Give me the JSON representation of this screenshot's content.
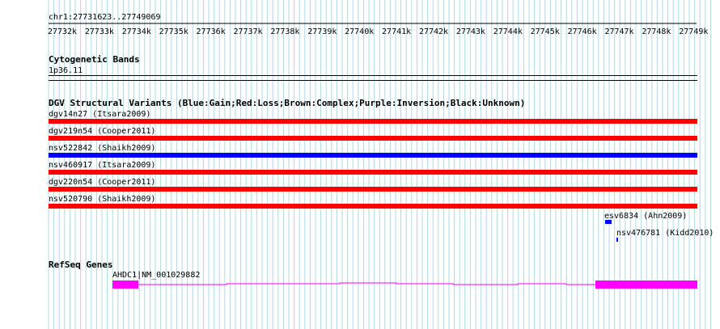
{
  "ruler": {
    "position": "chr1:27731623..27749069",
    "ticks": [
      "27732k",
      "27733k",
      "27734k",
      "27735k",
      "27736k",
      "27737k",
      "27738k",
      "27739k",
      "27740k",
      "27741k",
      "27742k",
      "27743k",
      "27744k",
      "27745k",
      "27746k",
      "27747k",
      "27748k",
      "27749k"
    ]
  },
  "cytoband": {
    "title": "Cytogenetic Bands",
    "band": "1p36.11"
  },
  "dgv": {
    "title": "DGV Structural Variants (Blue:Gain;Red:Loss;Brown:Complex;Purple:Inversion;Black:Unknown)",
    "variants": [
      {
        "label": "dgv14n27 (Itsara2009)",
        "color": "#ff0000"
      },
      {
        "label": "dgv219n54 (Cooper2011)",
        "color": "#ff0000"
      },
      {
        "label": "nsv522842 (Shaikh2009)",
        "color": "#0000ff"
      },
      {
        "label": "nsv460917 (Itsara2009)",
        "color": "#ff0000"
      },
      {
        "label": "dgv220n54 (Cooper2011)",
        "color": "#ff0000"
      },
      {
        "label": "nsv520790 (Shaikh2009)",
        "color": "#ff0000"
      }
    ],
    "small_variants": [
      {
        "label": "esv6834 (Ahn2009)",
        "color": "#0000ff"
      },
      {
        "label": "nsv476781 (Kidd2010)",
        "color": "#0000ff"
      }
    ]
  },
  "refseq": {
    "title": "RefSeq Genes",
    "gene_label": "AHDC1|NM_001029882",
    "gene_color": "#ff00ff"
  },
  "colors": {
    "grid": "#add8e6",
    "loss": "#ff0000",
    "gain": "#0000ff",
    "gene": "#ff00ff"
  }
}
